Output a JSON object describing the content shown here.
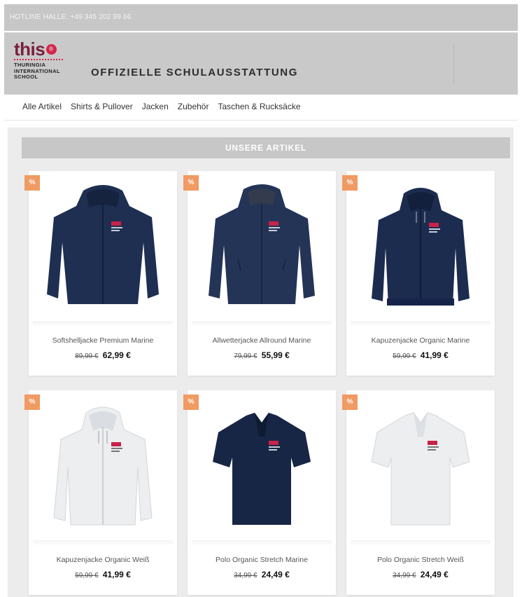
{
  "hotline": "HOTLINE HALLE: +49 345 202 99 66",
  "logo": {
    "word": "this",
    "sub_lines": [
      "THURINGIA",
      "INTERNATIONAL",
      "SCHOOL"
    ]
  },
  "header": {
    "title": "OFFIZIELLE SCHULAUSSTATTUNG"
  },
  "nav": [
    "Alle Artikel",
    "Shirts & Pullover",
    "Jacken",
    "Zubehör",
    "Taschen & Rucksäcke"
  ],
  "section_title": "UNSERE ARTIKEL",
  "badge_label": "%",
  "colors": {
    "brand": "#7a1f3d",
    "brand_accent": "#d6244a",
    "badge": "#f09a64",
    "navy": "#1e2f52",
    "white_garment": "#eceeef"
  },
  "products": [
    {
      "name": "Softshelljacke Premium Marine",
      "old_price": "89,99 €",
      "price": "62,99 €",
      "icon": "softshell-jacket-icon"
    },
    {
      "name": "Allwetterjacke Allround Marine",
      "old_price": "79,99 €",
      "price": "55,99 €",
      "icon": "allweather-jacket-icon"
    },
    {
      "name": "Kapuzenjacke Organic Marine",
      "old_price": "59,99 €",
      "price": "41,99 €",
      "icon": "hoodie-jacket-navy-icon"
    },
    {
      "name": "Kapuzenjacke Organic Weiß",
      "old_price": "59,99 €",
      "price": "41,99 €",
      "icon": "hoodie-jacket-white-icon"
    },
    {
      "name": "Polo Organic Stretch Marine",
      "old_price": "34,99 €",
      "price": "24,49 €",
      "icon": "polo-navy-icon"
    },
    {
      "name": "Polo Organic Stretch Weiß",
      "old_price": "34,99 €",
      "price": "24,49 €",
      "icon": "polo-white-icon"
    }
  ]
}
